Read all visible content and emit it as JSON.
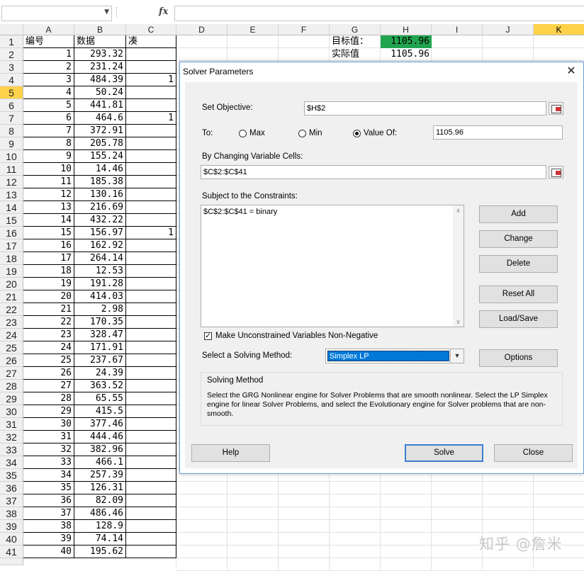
{
  "formula_bar": {
    "name_box": "",
    "fx": "fx",
    "formula": ""
  },
  "columns": [
    "A",
    "B",
    "C",
    "D",
    "E",
    "F",
    "G",
    "H",
    "I",
    "J",
    "K"
  ],
  "selected_column": "K",
  "selected_row": 5,
  "header_row": {
    "a": "编号",
    "b": "数据",
    "c": "凑"
  },
  "rows": [
    {
      "n": "2",
      "a": "1",
      "b": "293.32",
      "c": ""
    },
    {
      "n": "3",
      "a": "2",
      "b": "231.24",
      "c": ""
    },
    {
      "n": "4",
      "a": "3",
      "b": "484.39",
      "c": "1"
    },
    {
      "n": "5",
      "a": "4",
      "b": "50.24",
      "c": ""
    },
    {
      "n": "6",
      "a": "5",
      "b": "441.81",
      "c": ""
    },
    {
      "n": "7",
      "a": "6",
      "b": "464.6",
      "c": "1"
    },
    {
      "n": "8",
      "a": "7",
      "b": "372.91",
      "c": ""
    },
    {
      "n": "9",
      "a": "8",
      "b": "205.78",
      "c": ""
    },
    {
      "n": "10",
      "a": "9",
      "b": "155.24",
      "c": ""
    },
    {
      "n": "11",
      "a": "10",
      "b": "14.46",
      "c": ""
    },
    {
      "n": "12",
      "a": "11",
      "b": "185.38",
      "c": ""
    },
    {
      "n": "13",
      "a": "12",
      "b": "130.16",
      "c": ""
    },
    {
      "n": "14",
      "a": "13",
      "b": "216.69",
      "c": ""
    },
    {
      "n": "15",
      "a": "14",
      "b": "432.22",
      "c": ""
    },
    {
      "n": "16",
      "a": "15",
      "b": "156.97",
      "c": "1"
    },
    {
      "n": "17",
      "a": "16",
      "b": "162.92",
      "c": ""
    },
    {
      "n": "18",
      "a": "17",
      "b": "264.14",
      "c": ""
    },
    {
      "n": "19",
      "a": "18",
      "b": "12.53",
      "c": ""
    },
    {
      "n": "20",
      "a": "19",
      "b": "191.28",
      "c": ""
    },
    {
      "n": "21",
      "a": "20",
      "b": "414.03",
      "c": ""
    },
    {
      "n": "22",
      "a": "21",
      "b": "2.98",
      "c": ""
    },
    {
      "n": "23",
      "a": "22",
      "b": "170.35",
      "c": ""
    },
    {
      "n": "24",
      "a": "23",
      "b": "328.47",
      "c": ""
    },
    {
      "n": "25",
      "a": "24",
      "b": "171.91",
      "c": ""
    },
    {
      "n": "26",
      "a": "25",
      "b": "237.67",
      "c": ""
    },
    {
      "n": "27",
      "a": "26",
      "b": "24.39",
      "c": ""
    },
    {
      "n": "28",
      "a": "27",
      "b": "363.52",
      "c": ""
    },
    {
      "n": "29",
      "a": "28",
      "b": "65.55",
      "c": ""
    },
    {
      "n": "30",
      "a": "29",
      "b": "415.5",
      "c": ""
    },
    {
      "n": "31",
      "a": "30",
      "b": "377.46",
      "c": ""
    },
    {
      "n": "32",
      "a": "31",
      "b": "444.46",
      "c": ""
    },
    {
      "n": "33",
      "a": "32",
      "b": "382.96",
      "c": ""
    },
    {
      "n": "34",
      "a": "33",
      "b": "466.1",
      "c": ""
    },
    {
      "n": "35",
      "a": "34",
      "b": "257.39",
      "c": ""
    },
    {
      "n": "36",
      "a": "35",
      "b": "126.31",
      "c": ""
    },
    {
      "n": "37",
      "a": "36",
      "b": "82.09",
      "c": ""
    },
    {
      "n": "38",
      "a": "37",
      "b": "486.46",
      "c": ""
    },
    {
      "n": "39",
      "a": "38",
      "b": "128.9",
      "c": ""
    },
    {
      "n": "40",
      "a": "39",
      "b": "74.14",
      "c": ""
    },
    {
      "n": "41",
      "a": "40",
      "b": "195.62",
      "c": ""
    }
  ],
  "target_label": "目标值：",
  "target_value": "1105.96",
  "actual_label": "实际值",
  "actual_value": "1105.96",
  "target_fill": "#21a44f",
  "dialog": {
    "title": "Solver Parameters",
    "close": "✕",
    "set_objective_label": "Set Objective:",
    "set_objective_value": "$H$2",
    "to_label": "To:",
    "max_label": "Max",
    "min_label": "Min",
    "value_of_label": "Value Of:",
    "value_of": "1105.96",
    "changing_label": "By Changing Variable Cells:",
    "changing_value": "$C$2:$C$41",
    "constraints_label": "Subject to the Constraints:",
    "constraints": [
      "$C$2:$C$41 = binary"
    ],
    "add": "Add",
    "change": "Change",
    "delete": "Delete",
    "reset_all": "Reset All",
    "load_save": "Load/Save",
    "nonneg_label": "Make Unconstrained Variables Non-Negative",
    "nonneg_checked": true,
    "method_label": "Select a Solving Method:",
    "method_value": "Simplex LP",
    "options": "Options",
    "group_title": "Solving Method",
    "group_text": "Select the GRG Nonlinear engine for Solver Problems that are smooth nonlinear. Select the LP Simplex engine for linear Solver Problems, and select the Evolutionary engine for Solver problems that are non-smooth.",
    "help": "Help",
    "solve": "Solve",
    "close_btn": "Close"
  },
  "watermark": "知乎 @詹米"
}
